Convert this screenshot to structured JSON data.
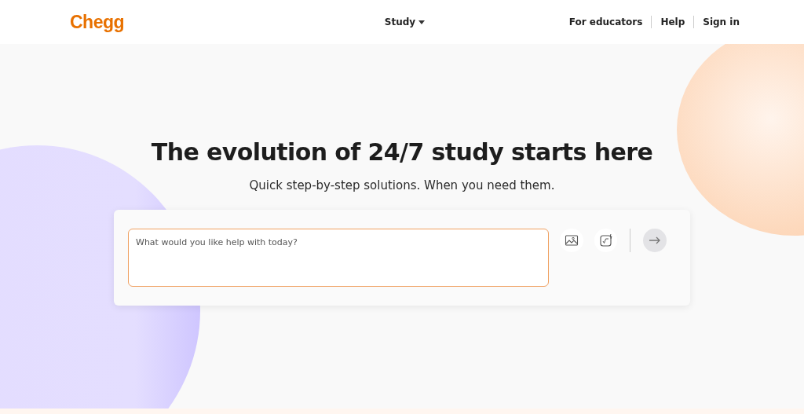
{
  "header": {
    "logo": "Chegg",
    "nav": [
      {
        "label": "Study",
        "dropdown": true
      }
    ],
    "links": [
      "For educators",
      "Help",
      "Sign in"
    ]
  },
  "hero": {
    "title": "The evolution of 24/7 study starts here",
    "subtitle": "Quick step-by-step solutions. When you need them.",
    "search": {
      "placeholder": "What would you like help with today?"
    }
  }
}
